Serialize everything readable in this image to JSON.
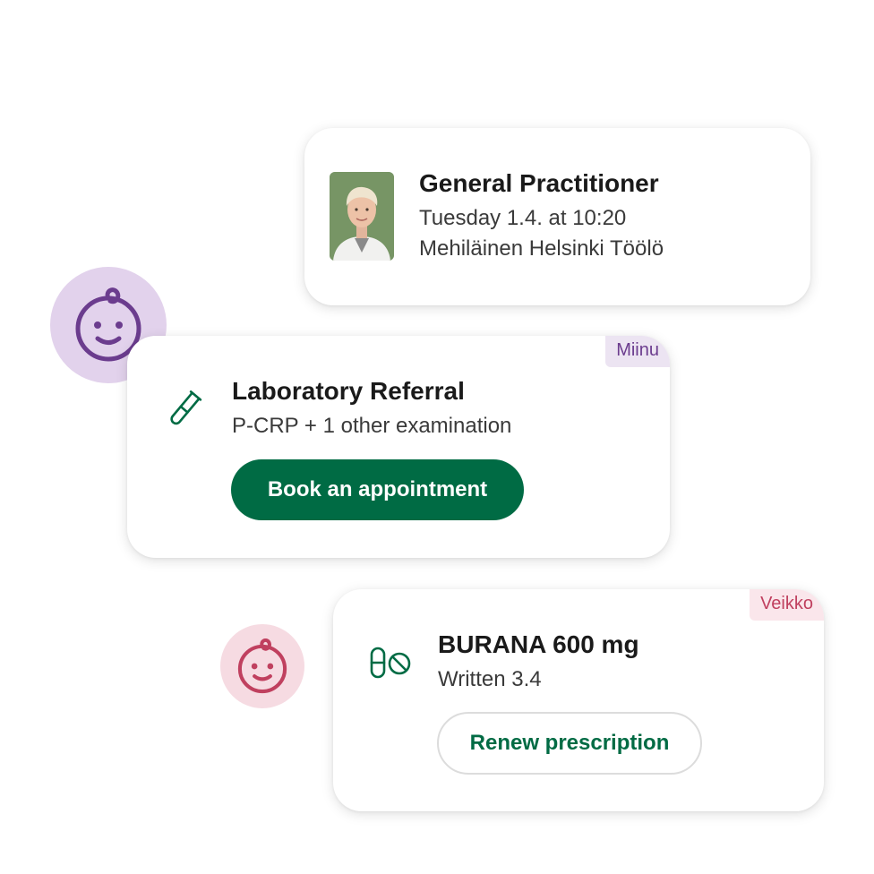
{
  "appointment": {
    "title": "General Practitioner",
    "datetime": "Tuesday 1.4. at 10:20",
    "location": "Mehiläinen Helsinki Töölö",
    "photo_icon": "doctor-photo"
  },
  "lab_referral": {
    "tag": "Miinu",
    "title": "Laboratory Referral",
    "description": "P-CRP + 1 other examination",
    "button_label": "Book an appointment",
    "icon": "test-tube-icon",
    "avatar_icon": "baby-face-icon"
  },
  "prescription": {
    "tag": "Veikko",
    "title": "BURANA 600 mg",
    "written": "Written 3.4",
    "button_label": "Renew prescription",
    "icon": "pills-icon",
    "avatar_icon": "baby-face-icon"
  },
  "colors": {
    "brand_green": "#006b44",
    "miinu_bg": "#e2d2ec",
    "miinu_fg": "#6b3c8e",
    "veikko_bg": "#f6dbe2",
    "veikko_fg": "#c0405f"
  }
}
